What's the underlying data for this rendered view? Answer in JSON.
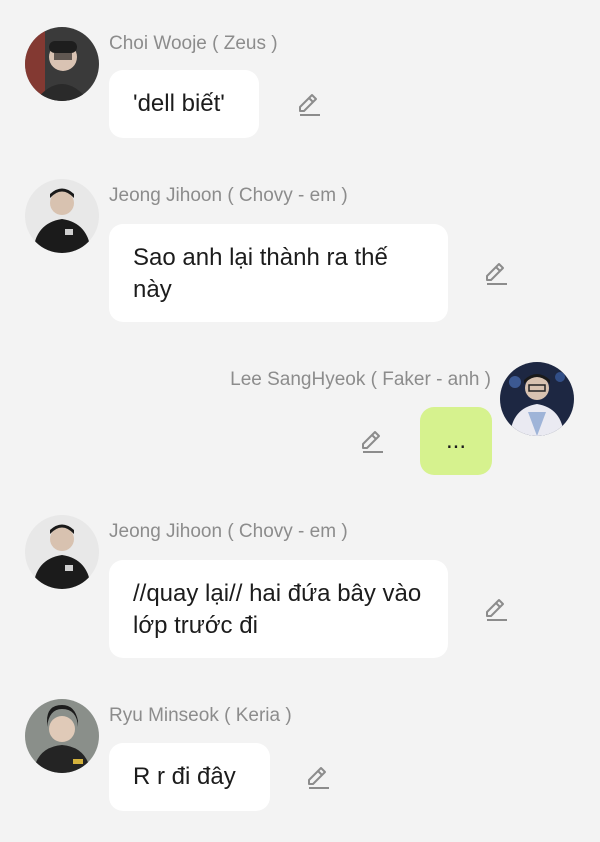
{
  "messages": [
    {
      "sender": "Choi Wooje ( Zeus )",
      "text": "'dell biết'",
      "side": "left",
      "avatar": "zeus-avatar"
    },
    {
      "sender": "Jeong Jihoon ( Chovy - em  )",
      "text": "Sao anh lại thành ra thế này",
      "side": "left",
      "avatar": "chovy-avatar"
    },
    {
      "sender": "Lee SangHyeok ( Faker - anh )",
      "text": "...",
      "side": "right",
      "avatar": "faker-avatar"
    },
    {
      "sender": "Jeong Jihoon ( Chovy - em  )",
      "text": "//quay lại// hai đứa bây vào lớp trước đi",
      "side": "left",
      "avatar": "chovy-avatar"
    },
    {
      "sender": "Ryu Minseok ( Keria )",
      "text": "R r đi đây",
      "side": "left",
      "avatar": "keria-avatar"
    }
  ],
  "icons": {
    "edit": "pencil-edit-icon"
  },
  "colors": {
    "background": "#f3f3f3",
    "bubble": "#ffffff",
    "own_bubble": "#d6f28e",
    "sender_text": "#8c8c8c",
    "message_text": "#1c1c1c"
  }
}
